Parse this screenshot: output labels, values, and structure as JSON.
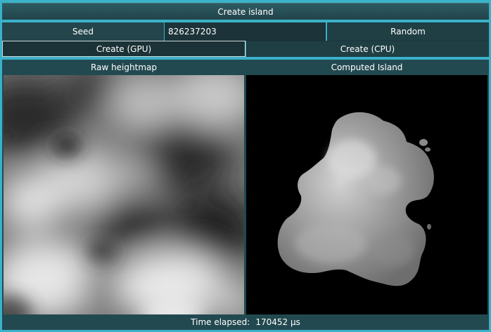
{
  "window": {
    "title": "Create island"
  },
  "seed": {
    "label": "Seed",
    "value": "826237203"
  },
  "buttons": {
    "random": "Random",
    "create_gpu": "Create (GPU)",
    "create_cpu": "Create (CPU)"
  },
  "panels": {
    "raw": "Raw heightmap",
    "computed": "Computed Island"
  },
  "status": {
    "label": "Time elapsed:",
    "value": "170452 µs"
  }
}
